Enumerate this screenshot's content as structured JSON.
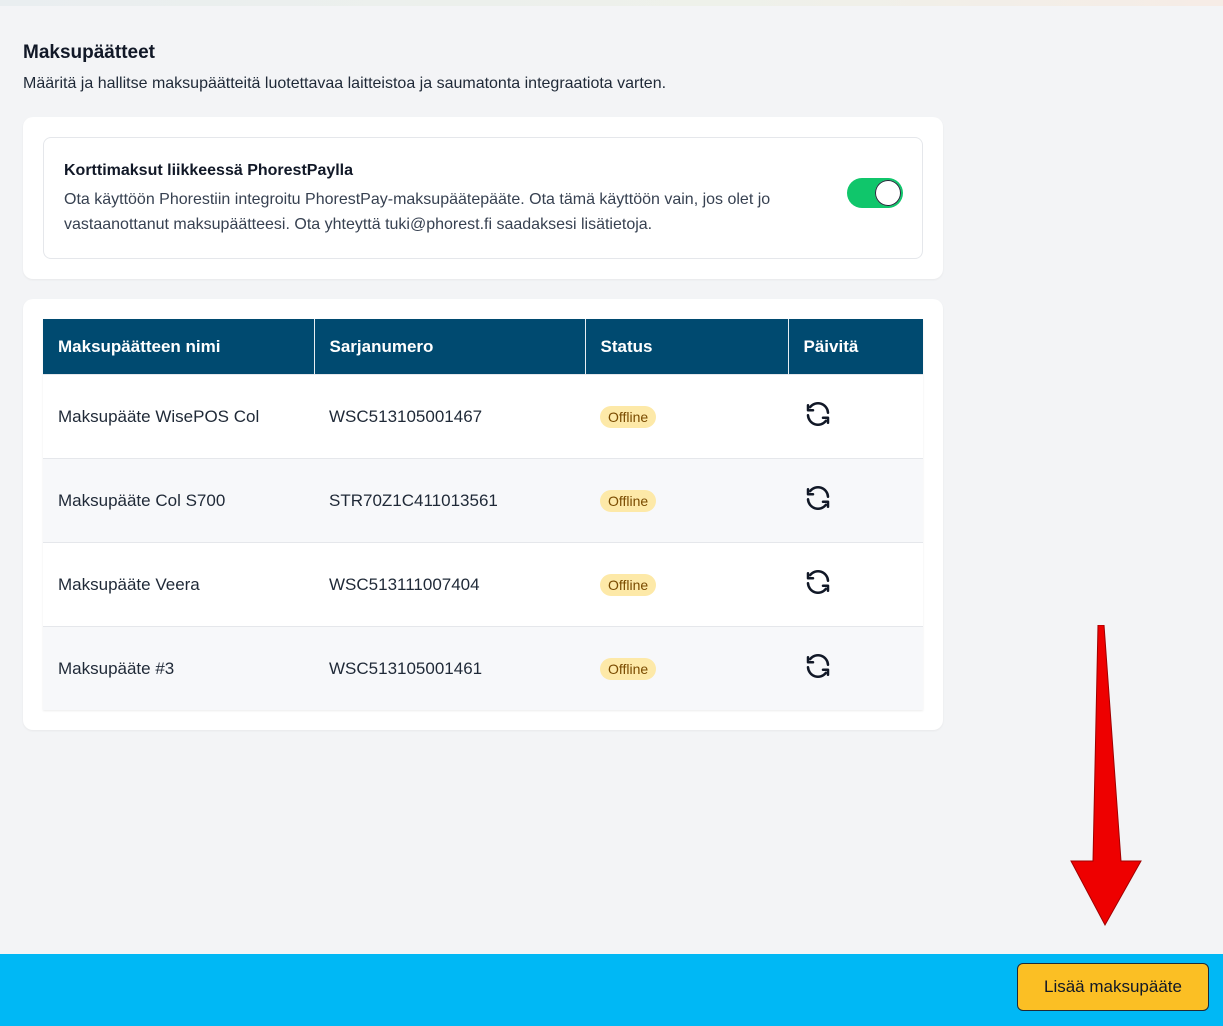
{
  "page": {
    "title": "Maksupäätteet",
    "description": "Määritä ja hallitse maksupäätteitä luotettavaa laitteistoa ja saumatonta integraatiota varten."
  },
  "phorestpay": {
    "title": "Korttimaksut liikkeessä PhorestPaylla",
    "text": "Ota käyttöön Phorestiin integroitu PhorestPay-maksupäätepääte. Ota tämä käyttöön vain, jos olet jo vastaanottanut maksupäätteesi. Ota yhteyttä tuki@phorest.fi saadaksesi lisätietoja.",
    "enabled": true,
    "toggle_color": "#10c66b"
  },
  "table": {
    "headers": [
      "Maksupäätteen nimi",
      "Sarjanumero",
      "Status",
      "Päivitä"
    ],
    "rows": [
      {
        "name": "Maksupääte WisePOS Col",
        "serial": "WSC513105001467",
        "status": "Offline"
      },
      {
        "name": "Maksupääte Col S700",
        "serial": "STR70Z1C411013561",
        "status": "Offline"
      },
      {
        "name": "Maksupääte Veera",
        "serial": "WSC513111007404",
        "status": "Offline"
      },
      {
        "name": "Maksupääte #3",
        "serial": "WSC513105001461",
        "status": "Offline"
      }
    ],
    "header_color": "#004a70",
    "refresh_icon": "refresh-icon"
  },
  "footer": {
    "add_button_label": "Lisää maksupääte",
    "bar_color": "#00b8f5",
    "button_color": "#fbbf24"
  },
  "annotation": {
    "arrow_color": "#ee0000",
    "arrow_icon": "arrow-down-icon"
  }
}
